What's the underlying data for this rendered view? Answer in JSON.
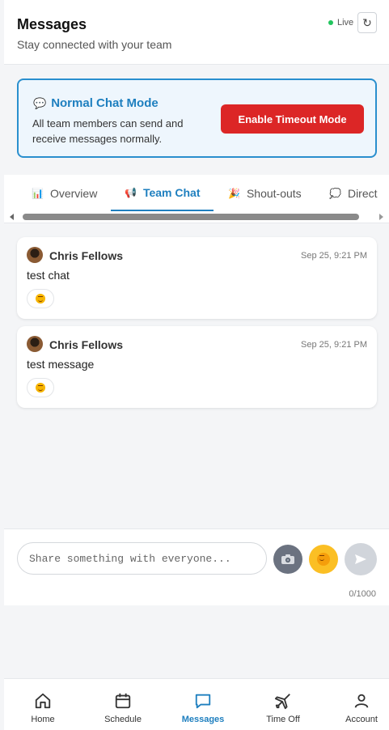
{
  "header": {
    "title": "Messages",
    "subtitle": "Stay connected with your team",
    "live_label": "Live",
    "refresh_icon": "↻"
  },
  "mode_card": {
    "icon": "💬",
    "title": "Normal Chat Mode",
    "description": "All team members can send and receive messages normally.",
    "button_label": "Enable Timeout Mode"
  },
  "tabs": [
    {
      "icon": "📊",
      "label": "Overview"
    },
    {
      "icon": "📢",
      "label": "Team Chat"
    },
    {
      "icon": "🎉",
      "label": "Shout-outs"
    },
    {
      "icon": "💭",
      "label": "Direct"
    }
  ],
  "active_tab": "Team Chat",
  "messages": [
    {
      "author": "Chris Fellows",
      "time": "Sep 25, 9:21 PM",
      "text": "test chat"
    },
    {
      "author": "Chris Fellows",
      "time": "Sep 25, 9:21 PM",
      "text": "test message"
    }
  ],
  "composer": {
    "placeholder": "Share something with everyone...",
    "char_count": "0/1000"
  },
  "nav": [
    {
      "label": "Home",
      "icon": "home-icon"
    },
    {
      "label": "Schedule",
      "icon": "calendar-icon"
    },
    {
      "label": "Messages",
      "icon": "chat-icon"
    },
    {
      "label": "Time Off",
      "icon": "plane-icon"
    },
    {
      "label": "Account",
      "icon": "user-icon"
    }
  ],
  "active_nav": "Messages",
  "colors": {
    "accent": "#1e7fbf",
    "danger": "#dc2626",
    "live": "#22c55e"
  }
}
